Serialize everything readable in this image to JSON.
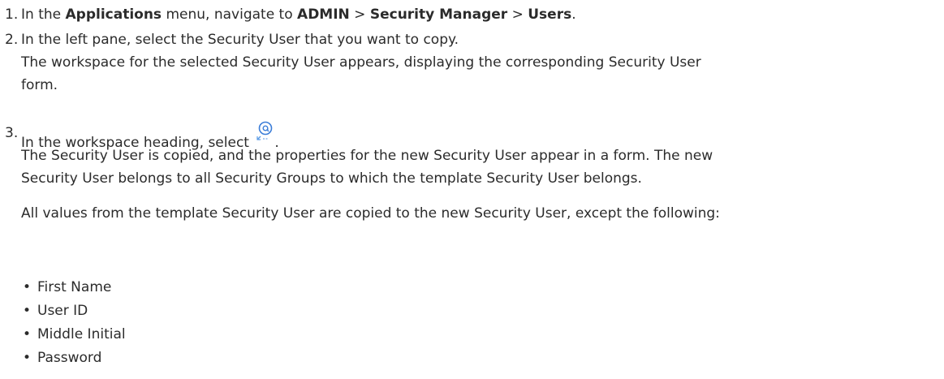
{
  "steps": [
    {
      "number": "1.",
      "parts": {
        "a": "In the ",
        "b": "Applications",
        "c": " menu, navigate to ",
        "d": "ADMIN",
        "e": " > ",
        "f": "Security Manager",
        "g": " > ",
        "h": "Users",
        "i": "."
      }
    },
    {
      "number": "2.",
      "line1": "In the left pane, select the Security User that you want to copy.",
      "line2": "The workspace for the selected Security User appears, displaying the corresponding Security User",
      "line3": "form."
    },
    {
      "number": "3.",
      "line1_before": "In the workspace heading, select",
      "line1_after": ".",
      "icon": "copy-user-icon",
      "line2": "The Security User is copied, and the properties for the new Security User appear in a form. The new",
      "line3": "Security User belongs to all Security Groups to which the template Security User belongs.",
      "line4": "All values from the template Security User are copied to the new Security User, except the following:"
    }
  ],
  "excluded_fields": [
    "First Name",
    "User ID",
    "Middle Initial",
    "Password"
  ],
  "bullet_char": "•",
  "colors": {
    "text": "#2b2b2b",
    "icon_blue": "#3b7dd8"
  }
}
